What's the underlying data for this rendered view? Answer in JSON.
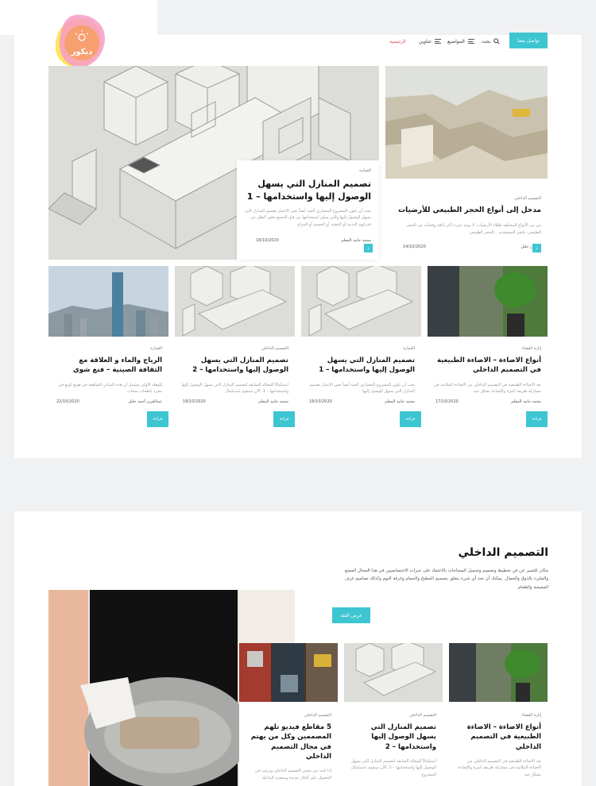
{
  "brand": {
    "logo_text": "ديكور"
  },
  "nav": {
    "cta": "تواصل معنا",
    "search": "بحث",
    "topics": "المواضيع",
    "addresses": "عناوين",
    "home": "الرئيسية"
  },
  "featured": [
    {
      "category": "العمارة",
      "title": "تصميم المنازل التي يسهل الوصول إليها واستخدامها – 1",
      "excerpt": "يجب أن يكون المشروع المعماري الجيد أيضاً بعين الاعتبار تصميم المنازل التي يسهل الوصول إليها والتي يمكن استخدامها من قبل الجميع بغض النظر عن قدراتهم البدنية أو الذهنية أو الحسية أو المزاج",
      "author": "محمد حامد المعلم",
      "date": "18/10/2020"
    },
    {
      "category": "التصميم الداخلي",
      "title": "مدخل إلى أنواع الحجر الطبيعي للأرضيات",
      "excerpt": "من بين الأنواع المختلفة لطلاء الأرضيات، لا يوجد شيء أكثر أناقة وفخامة من الحجر الطبيعي، يلتقي المستخدم ...الحجر الطبيعي",
      "author": "نسرين خليل",
      "date": "14/10/2020"
    }
  ],
  "row_cards": [
    {
      "category": "العمارة",
      "title": "الرياح والماء و العلاقة مع الثقافة الصينية – فنغ شوي",
      "excerpt": "للوهلة الأولى يشتمل أن هذه المباني الشاهقة في هونغ كونغ في مجرد ناطحات سحاب",
      "author": "عبدالعزيز أحمد خليل",
      "date": "22/10/2020",
      "read": "قراءة"
    },
    {
      "category": "التصميم الداخلي",
      "title": "تصميم المنازل التي يسهل الوصول إليها واستخدامها – 2",
      "excerpt": "استكمالاً للمقالة السابقة لتصميم المنازل التي يسهل الوصول إليها واستخدامها – 1، الآن سنقوم باستكمال",
      "author": "محمد حامد المعلم",
      "date": "18/10/2020",
      "read": "قراءة"
    },
    {
      "category": "العمارة",
      "title": "تصميم المنازل التي يسهل الوصول إليها واستخدامها – 1",
      "excerpt": "يجب أن يكون المشروع المعماري الجيد أيضاً بعين الاعتبار تصميم المنازل التي يسهل الوصول إليها",
      "author": "محمد حامد المعلم",
      "date": "18/10/2020",
      "read": "قراءة"
    },
    {
      "category": "إنارة الفضاء",
      "title": "أنواع الاضاءة – الاضاءة الطبيعية في التصميم الداخلي",
      "excerpt": "تعد الاضاءة الطبيعية في التصميم الداخلي من الاضاءة الملائمة في مشاركة طريقة كثيرة والإضاءة بشكل جيد",
      "author": "محمد حامد المعلم",
      "date": "17/10/2020",
      "read": "قراءة"
    }
  ],
  "section2": {
    "title": "التصميم الداخلي",
    "description": "مكان للتعبير عن فن تخطيط وتصميم وتجميل المساحات بالاعتماد على خبرات الاختصاصيين في هذا المجال الممتع والمليء بالذوق والجمال. يمكنك أن تجد أي شيء يتعلق بتصميم المطبخ والحمام وغرفة النوم وكذلك تصاميم غرف المعيشة والطعام",
    "button": "عرض الفئة",
    "cards": [
      {
        "category": "التصميم الداخلي",
        "title": "5 مقاطع فيديو تلهم المصممين وكل من يهتم في مجال التصميم الداخلي",
        "excerpt": "إذا كنت من محبي التصميم الداخلي وترغب في الحصول على أفكار جديدة ومحفزة لإبداعك"
      },
      {
        "category": "التصميم الداخلي",
        "title": "تصميم المنازل التي يسهل الوصول إليها واستخدامها – 2",
        "excerpt": "استكمالاً للمقالة السابقة لتصميم المنازل التي يسهل الوصول إليها واستخدامها – 1، الآن سنقوم باستكمال المشروع"
      },
      {
        "category": "إنارة الفضاء",
        "title": "أنواع الاضاءة – الاضاءة الطبيعية في التصميم الداخلي",
        "excerpt": "تعد الاضاءة الطبيعية في التصميم الداخلي من الاضاءة الملائمة في مشاركة طريقة كثيرة والإضاءة بشكل جيد"
      }
    ]
  },
  "colors": {
    "accent": "#3ec5d2",
    "background": "#f0f1f3"
  }
}
